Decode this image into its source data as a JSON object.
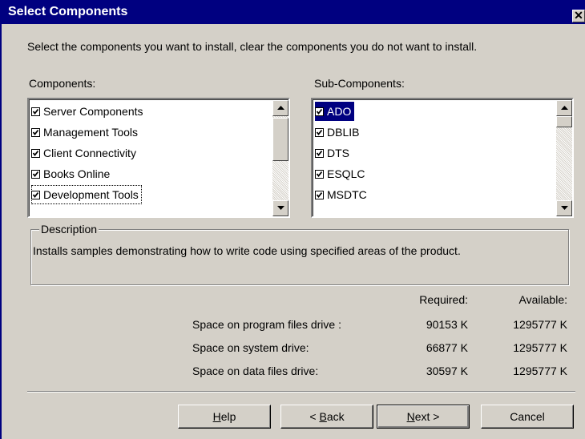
{
  "window": {
    "title": "Select Components",
    "close_glyph": "✕"
  },
  "instruction": "Select the components you want to install, clear the components you do not want to install.",
  "components": {
    "label": "Components:",
    "items": [
      {
        "label": "Server Components",
        "checked": true
      },
      {
        "label": "Management Tools",
        "checked": true
      },
      {
        "label": "Client Connectivity",
        "checked": true
      },
      {
        "label": "Books Online",
        "checked": true
      },
      {
        "label": "Development Tools",
        "checked": true,
        "focused": true
      }
    ]
  },
  "subcomponents": {
    "label": "Sub-Components:",
    "items": [
      {
        "label": "ADO",
        "checked": true,
        "selected": true
      },
      {
        "label": "DBLIB",
        "checked": true
      },
      {
        "label": "DTS",
        "checked": true
      },
      {
        "label": "ESQLC",
        "checked": true
      },
      {
        "label": "MSDTC",
        "checked": true
      }
    ]
  },
  "description": {
    "legend": "Description",
    "text": "Installs samples demonstrating how to write code using specified areas of the product."
  },
  "space": {
    "required_header": "Required:",
    "available_header": "Available:",
    "rows": [
      {
        "label": "Space on program files drive :",
        "required": "90153 K",
        "available": "1295777 K"
      },
      {
        "label": "Space on system drive:",
        "required": "66877 K",
        "available": "1295777 K"
      },
      {
        "label": "Space on data files drive:",
        "required": "30597 K",
        "available": "1295777 K"
      }
    ]
  },
  "buttons": {
    "help": {
      "accel": "H",
      "rest": "elp"
    },
    "back": {
      "prefix": "< ",
      "accel": "B",
      "rest": "ack"
    },
    "next": {
      "accel": "N",
      "rest": "ext >"
    },
    "cancel": "Cancel"
  }
}
